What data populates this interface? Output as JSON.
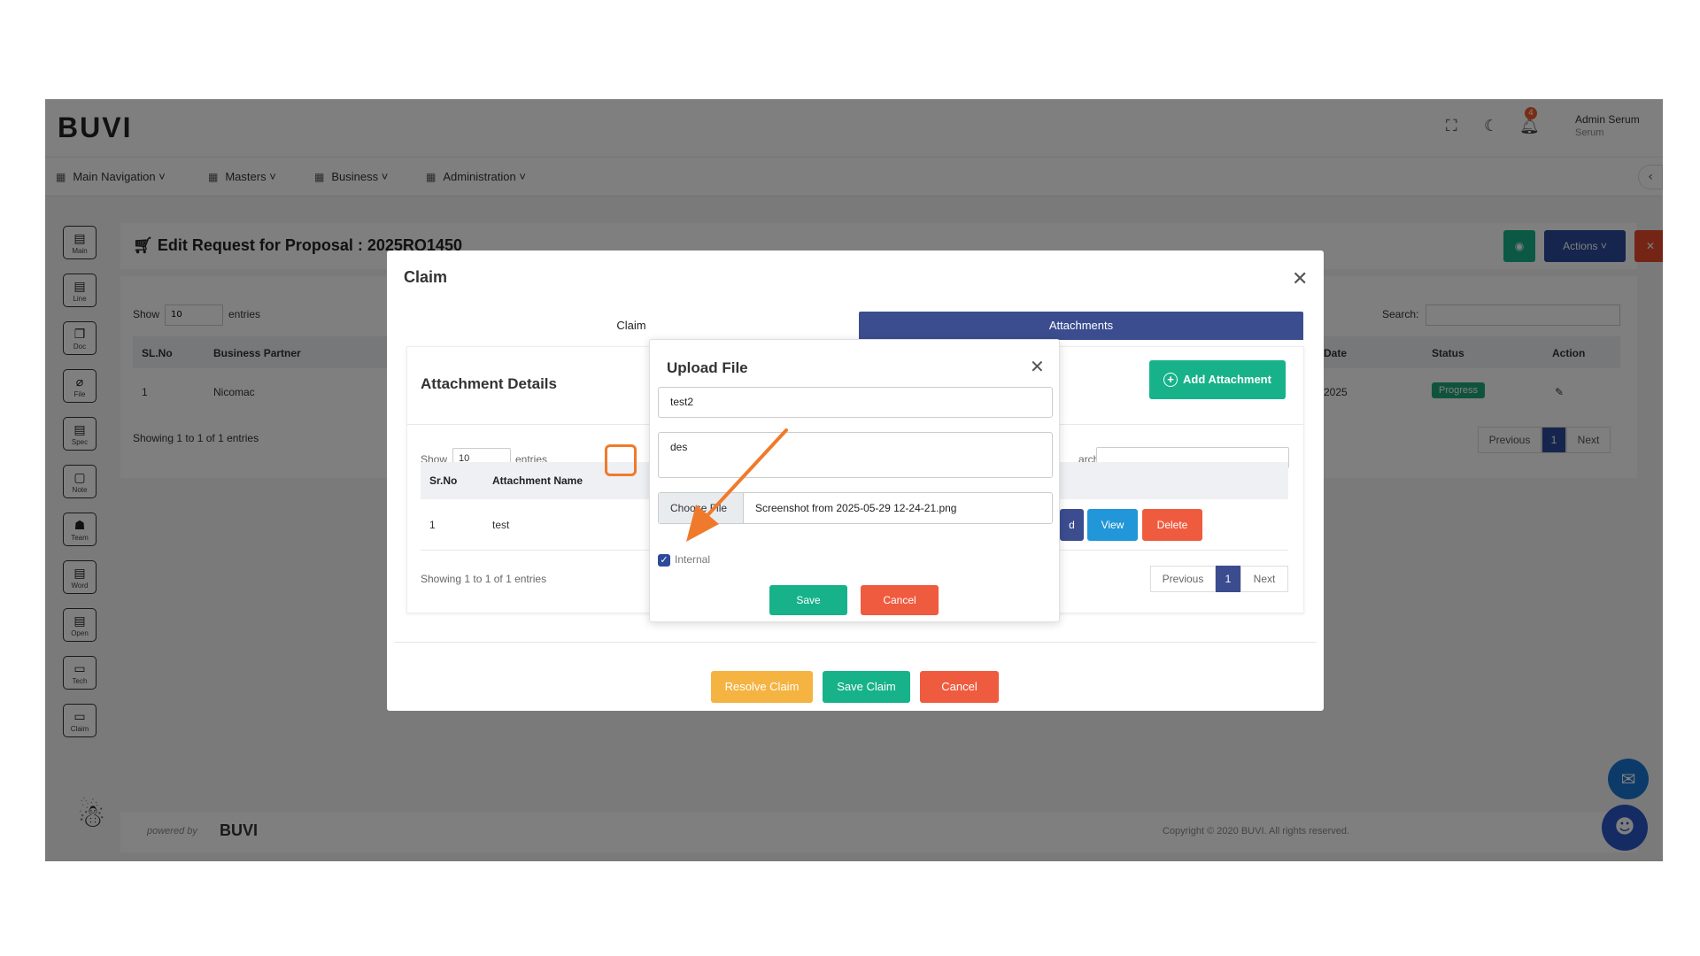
{
  "app": {
    "logo": "BUVI",
    "user_name": "Admin Serum",
    "user_sub": "Serum",
    "notification_count": "4"
  },
  "nav": [
    "Main Navigation",
    "Masters",
    "Business",
    "Administration"
  ],
  "sidebar": [
    "Main",
    "Line",
    "Doc",
    "File",
    "Spec",
    "Note",
    "Team",
    "Word",
    "Open",
    "Tech",
    "Claim"
  ],
  "page": {
    "title": "Edit Request for Proposal : 2025RQ1450",
    "actions_label": "Actions"
  },
  "bg_table": {
    "show": "Show",
    "entries_value": "10",
    "entries": "entries",
    "search": "Search:",
    "headers": [
      "SL.No",
      "Business Partner",
      "Date",
      "Status",
      "Action"
    ],
    "row": {
      "sl": "1",
      "partner": "Nicomac",
      "date": "2025",
      "status": "Progress"
    },
    "info": "Showing 1 to 1 of 1 entries",
    "prev": "Previous",
    "page": "1",
    "next": "Next"
  },
  "footer": {
    "powered": "powered by",
    "brand": "BUVI",
    "copyright": "Copyright © 2020 BUVI. All rights reserved."
  },
  "claim_modal": {
    "title": "Claim",
    "tabs": [
      "Claim",
      "Attachments"
    ],
    "active_tab": "Attachments",
    "att_title": "Attachment Details",
    "add_attachment": "Add Attachment",
    "show": "Show",
    "entries_value": "10",
    "entries": "entries",
    "search_partial": "arch:",
    "headers": [
      "Sr.No",
      "Attachment Name"
    ],
    "row": {
      "sr": "1",
      "name": "test"
    },
    "row_actions": {
      "partial": "d",
      "view": "View",
      "delete": "Delete"
    },
    "info": "Showing 1 to 1 of 1 entries",
    "prev": "Previous",
    "page": "1",
    "next": "Next",
    "buttons": {
      "resolve": "Resolve Claim",
      "save": "Save Claim",
      "cancel": "Cancel"
    }
  },
  "upload_modal": {
    "title": "Upload File",
    "name_value": "test2",
    "desc_value": "des",
    "choose_label": "Choose File",
    "file_name": "Screenshot from 2025-05-29 12-24-21.png",
    "internal_label": "Internal",
    "internal_checked": true,
    "save": "Save",
    "cancel": "Cancel"
  },
  "colors": {
    "accent_teal": "#17b28a",
    "tab_blue": "#3b4d8f",
    "delete_red": "#ef5b3f",
    "view_blue": "#2196d9",
    "resolve_orange": "#f5b342",
    "annotation_orange": "#f07a2b"
  }
}
